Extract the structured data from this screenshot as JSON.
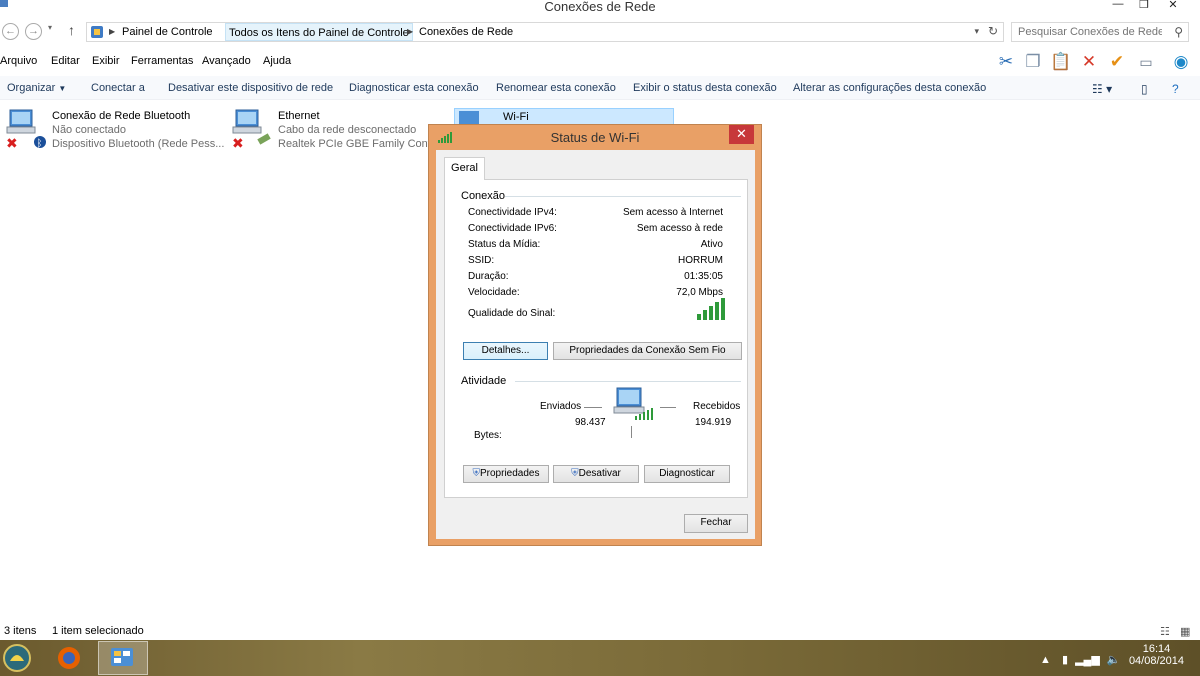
{
  "window": {
    "title": "Conexões de Rede"
  },
  "address": {
    "crumbs": [
      "Painel de Controle",
      "Todos os Itens do Painel de Controle",
      "Conexões de Rede"
    ],
    "search_placeholder": "Pesquisar Conexões de Rede"
  },
  "menubar": {
    "items": [
      "Arquivo",
      "Editar",
      "Exibir",
      "Ferramentas",
      "Avançado",
      "Ajuda"
    ]
  },
  "commands": {
    "items": [
      "Organizar",
      "Conectar a",
      "Desativar este dispositivo de rede",
      "Diagnosticar esta conexão",
      "Renomear esta conexão",
      "Exibir o status desta conexão",
      "Alterar as configurações desta conexão"
    ]
  },
  "connections": [
    {
      "name": "Conexão de Rede Bluetooth",
      "status": "Não conectado",
      "device": "Dispositivo Bluetooth (Rede Pess..."
    },
    {
      "name": "Ethernet",
      "status": "Cabo da rede desconectado",
      "device": "Realtek PCIe GBE Family Control..."
    },
    {
      "name": "Wi-Fi"
    }
  ],
  "dialog": {
    "title": "Status de Wi-Fi",
    "tab": "Geral",
    "connection_group": "Conexão",
    "rows": [
      {
        "label": "Conectividade IPv4:",
        "value": "Sem acesso à Internet"
      },
      {
        "label": "Conectividade IPv6:",
        "value": "Sem acesso à rede"
      },
      {
        "label": "Status da Mídia:",
        "value": "Ativo"
      },
      {
        "label": "SSID:",
        "value": "HORRUM"
      },
      {
        "label": "Duração:",
        "value": "01:35:05"
      },
      {
        "label": "Velocidade:",
        "value": "72,0 Mbps"
      }
    ],
    "signal_label": "Qualidade do Sinal:",
    "signal_level": 5,
    "details_button": "Detalhes...",
    "wireless_props_button": "Propriedades da Conexão Sem Fio",
    "activity_group": "Atividade",
    "sent_label": "Enviados",
    "received_label": "Recebidos",
    "bytes_label": "Bytes:",
    "sent_bytes": "98.437",
    "received_bytes": "194.919",
    "properties_button": "Propriedades",
    "disable_button": "Desativar",
    "diagnose_button": "Diagnosticar",
    "close_button": "Fechar"
  },
  "statusbar": {
    "count": "3 itens",
    "selected": "1 item selecionado"
  },
  "taskbar": {
    "time": "16:14",
    "date": "04/08/2014"
  },
  "colors": {
    "dialog_frame": "#e9a066",
    "close_red": "#c7383a",
    "signal_green": "#2e9a3a",
    "command_text": "#1e395b"
  }
}
